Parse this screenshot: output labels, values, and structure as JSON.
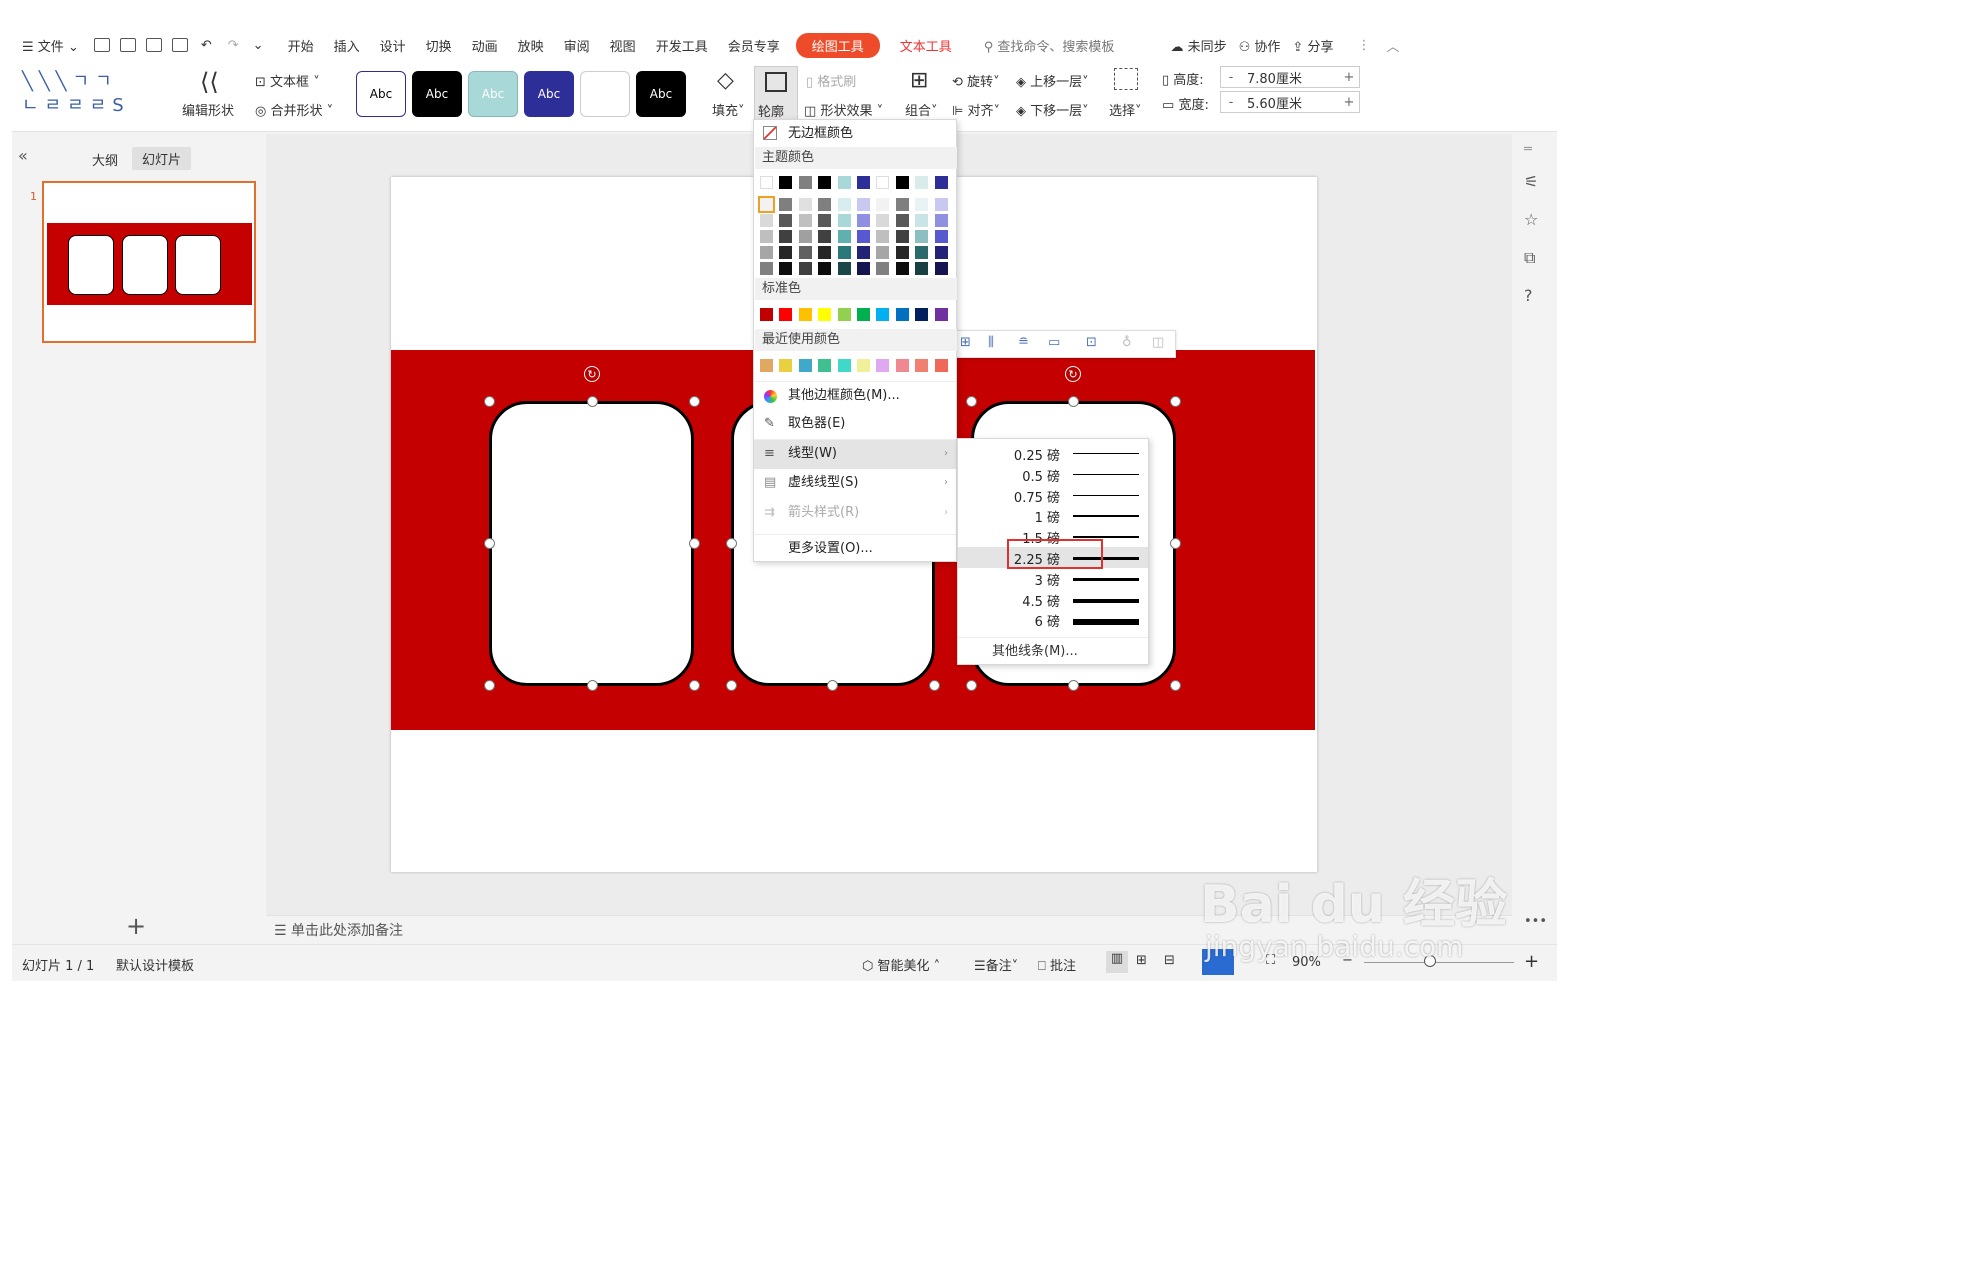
{
  "menu": {
    "file": "文件",
    "tabs": [
      "开始",
      "插入",
      "设计",
      "切换",
      "动画",
      "放映",
      "审阅",
      "视图",
      "开发工具",
      "会员专享"
    ],
    "active_tab": "绘图工具",
    "text_tab": "文本工具",
    "search": "查找命令、搜索模板",
    "unsynced": "未同步",
    "collab": "协作",
    "share": "分享"
  },
  "ribbon": {
    "edit_shape": "编辑形状",
    "text_box": "文本框",
    "merge_shape": "合并形状",
    "style_presets": [
      {
        "text": "Abc",
        "bg": "#ffffff",
        "fg": "#000000",
        "border": "#2e2e8f"
      },
      {
        "text": "Abc",
        "bg": "#000000",
        "fg": "#ffffff",
        "border": "#000000"
      },
      {
        "text": "Abc",
        "bg": "#a8d8d8",
        "fg": "#ffffff",
        "border": "#88b8b8"
      },
      {
        "text": "Abc",
        "bg": "#2e2e99",
        "fg": "#ffffff",
        "border": "#2e2e99"
      },
      {
        "text": "",
        "bg": "#ffffff",
        "fg": "#000000",
        "border": "#cccccc"
      },
      {
        "text": "Abc",
        "bg": "#000000",
        "fg": "#ffffff",
        "border": "#000000"
      }
    ],
    "fill": "填充",
    "outline": "轮廓",
    "format_painter": "格式刷",
    "shape_effect": "形状效果",
    "group": "组合",
    "rotate": "旋转",
    "align": "对齐",
    "bring_forward": "上移一层",
    "send_backward": "下移一层",
    "select": "选择",
    "height_label": "高度:",
    "height_value": "7.80厘米",
    "width_label": "宽度:",
    "width_value": "5.60厘米"
  },
  "leftpanel": {
    "outline_tab": "大纲",
    "slides_tab": "幻灯片",
    "slide_number": "1"
  },
  "outline_menu": {
    "no_border": "无边框颜色",
    "theme_colors": "主题颜色",
    "standard_colors": "标准色",
    "recent_colors": "最近使用颜色",
    "more_colors": "其他边框颜色(M)...",
    "eyedropper": "取色器(E)",
    "line_type": "线型(W)",
    "dash_type": "虚线线型(S)",
    "arrow_style": "箭头样式(R)",
    "more_settings": "更多设置(O)...",
    "theme_top": [
      "#ffffff",
      "#000000",
      "#808080",
      "#000000",
      "#a8d8d8",
      "#2e2e99",
      "#ffffff",
      "#000000",
      "#d8ecec",
      "#2e2e99"
    ],
    "standard": [
      "#c00000",
      "#ff0000",
      "#ffc000",
      "#ffff00",
      "#92d050",
      "#00b050",
      "#00b0f0",
      "#0070c0",
      "#002060",
      "#7030a0"
    ],
    "recent": [
      "#e0a860",
      "#e8d040",
      "#40a8c8",
      "#40c090",
      "#40d8c8",
      "#f0f098",
      "#e0a8f0",
      "#f08890",
      "#f08070",
      "#f06858"
    ]
  },
  "line_weights": {
    "items": [
      "0.25 磅",
      "0.5 磅",
      "0.75 磅",
      "1 磅",
      "1.5 磅",
      "2.25 磅",
      "3 磅",
      "4.5 磅",
      "6 磅"
    ],
    "selected": "2.25 磅",
    "more_lines": "其他线条(M)..."
  },
  "notes": "单击此处添加备注",
  "status": {
    "slide_info": "幻灯片 1 / 1",
    "template": "默认设计模板",
    "beautify": "智能美化",
    "notes": "备注",
    "comment": "批注",
    "zoom": "90%"
  },
  "watermark": {
    "brand": "Bai du 经验",
    "url": "jingyan.baidu.com"
  }
}
